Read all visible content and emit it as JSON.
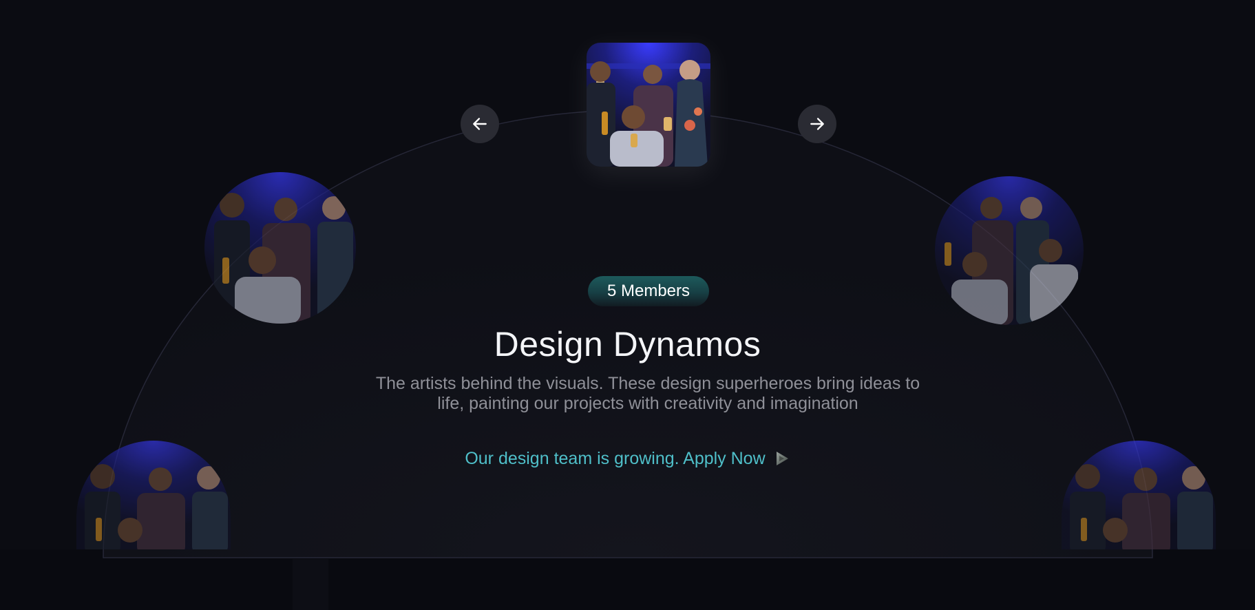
{
  "badge": {
    "members": "5 Members"
  },
  "team": {
    "title": "Design Dynamos",
    "description": "The artists behind the visuals. These design superheroes bring ideas to life, painting our projects with creativity and imagination",
    "apply_text": "Our design team is growing. Apply Now"
  },
  "navigation": {
    "prev_icon": "arrow-left-icon",
    "next_icon": "arrow-right-icon"
  },
  "colors": {
    "background": "#0b0c12",
    "accent": "#4fbfc9",
    "badge_green": "#1d5a5c",
    "button": "#2a2b33",
    "photo_blue": "#2a2ff0"
  }
}
